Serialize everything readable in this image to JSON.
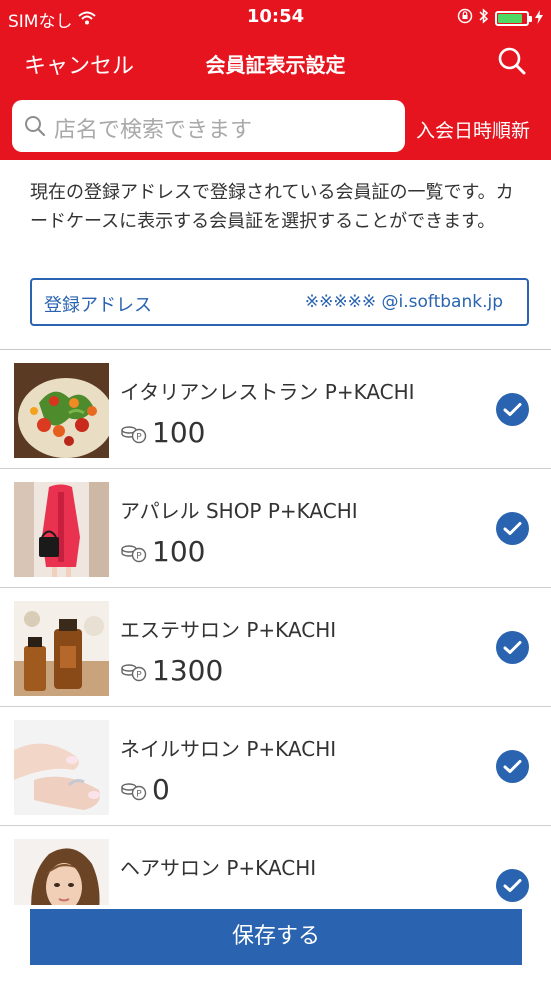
{
  "status": {
    "carrier": "SIMなし",
    "time": "10:54"
  },
  "nav": {
    "cancel_label": "キャンセル",
    "title": "会員証表示設定"
  },
  "search": {
    "placeholder": "店名で検索できます"
  },
  "sort": {
    "label": "入会日時順新"
  },
  "description": "現在の登録アドレスで登録されている会員証の一覧です。カードケースに表示する会員証を選択することができます。",
  "email": {
    "label": "登録アドレス",
    "value": "※※※※※ @i.softbank.jp"
  },
  "cards": [
    {
      "name": "イタリアンレストラン P+KACHI",
      "points": "100",
      "thumb_icon": "salad-photo",
      "checked": true
    },
    {
      "name": "アパレル SHOP P+KACHI",
      "points": "100",
      "thumb_icon": "fashion-photo",
      "checked": true
    },
    {
      "name": "エステサロン P+KACHI",
      "points": "1300",
      "thumb_icon": "spa-oil-photo",
      "checked": true
    },
    {
      "name": "ネイルサロン P+KACHI",
      "points": "0",
      "thumb_icon": "nail-photo",
      "checked": true
    },
    {
      "name": "ヘアサロン P+KACHI",
      "points": "",
      "thumb_icon": "hair-photo",
      "checked": true
    }
  ],
  "save": {
    "label": "保存する"
  },
  "colors": {
    "header_red": "#e6141e",
    "accent_blue": "#2a64b0"
  }
}
